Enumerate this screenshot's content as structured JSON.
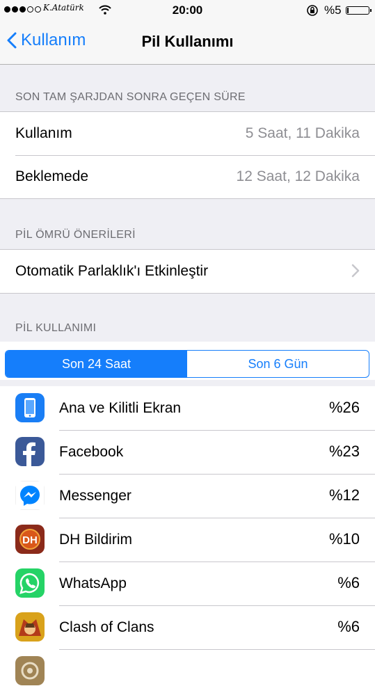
{
  "status_bar": {
    "time": "20:00",
    "battery_percent": "%5",
    "signature": "K.Atatürk",
    "signal_dots_filled": 3,
    "signal_dots_total": 5
  },
  "nav": {
    "back_label": "Kullanım",
    "title": "Pil Kullanımı"
  },
  "sections": {
    "since_charge_header": "SON TAM ŞARJDAN SONRA GEÇEN SÜRE",
    "usage_label": "Kullanım",
    "usage_value": "5 Saat, 11 Dakika",
    "standby_label": "Beklemede",
    "standby_value": "12 Saat, 12 Dakika",
    "suggestions_header": "PİL ÖMRÜ ÖNERİLERİ",
    "suggestion_label": "Otomatik Parlaklık'ı Etkinleştir",
    "battery_usage_header": "PİL KULLANIMI"
  },
  "segment": {
    "option_1": "Son 24 Saat",
    "option_2": "Son 6 Gün",
    "selected": "Son 24 Saat"
  },
  "apps": [
    {
      "name": "Ana ve Kilitli Ekran",
      "percent": "%26",
      "icon": "home-lock-screen-icon",
      "color": "#1a7ef5"
    },
    {
      "name": "Facebook",
      "percent": "%23",
      "icon": "facebook-icon",
      "color": "#3b5998"
    },
    {
      "name": "Messenger",
      "percent": "%12",
      "icon": "messenger-icon",
      "color": "#0084ff"
    },
    {
      "name": "DH Bildirim",
      "percent": "%10",
      "icon": "dh-bildirim-icon",
      "color": "#8b2a1a"
    },
    {
      "name": "WhatsApp",
      "percent": "%6",
      "icon": "whatsapp-icon",
      "color": "#25d366"
    },
    {
      "name": "Clash of Clans",
      "percent": "%6",
      "icon": "clash-of-clans-icon",
      "color": "#d9a21b"
    },
    {
      "name": "",
      "percent": "",
      "icon": "settings-icon",
      "color": "#a08455"
    }
  ],
  "colors": {
    "accent": "#157efb",
    "background": "#efeff4",
    "secondary_text": "#8e8e93"
  }
}
